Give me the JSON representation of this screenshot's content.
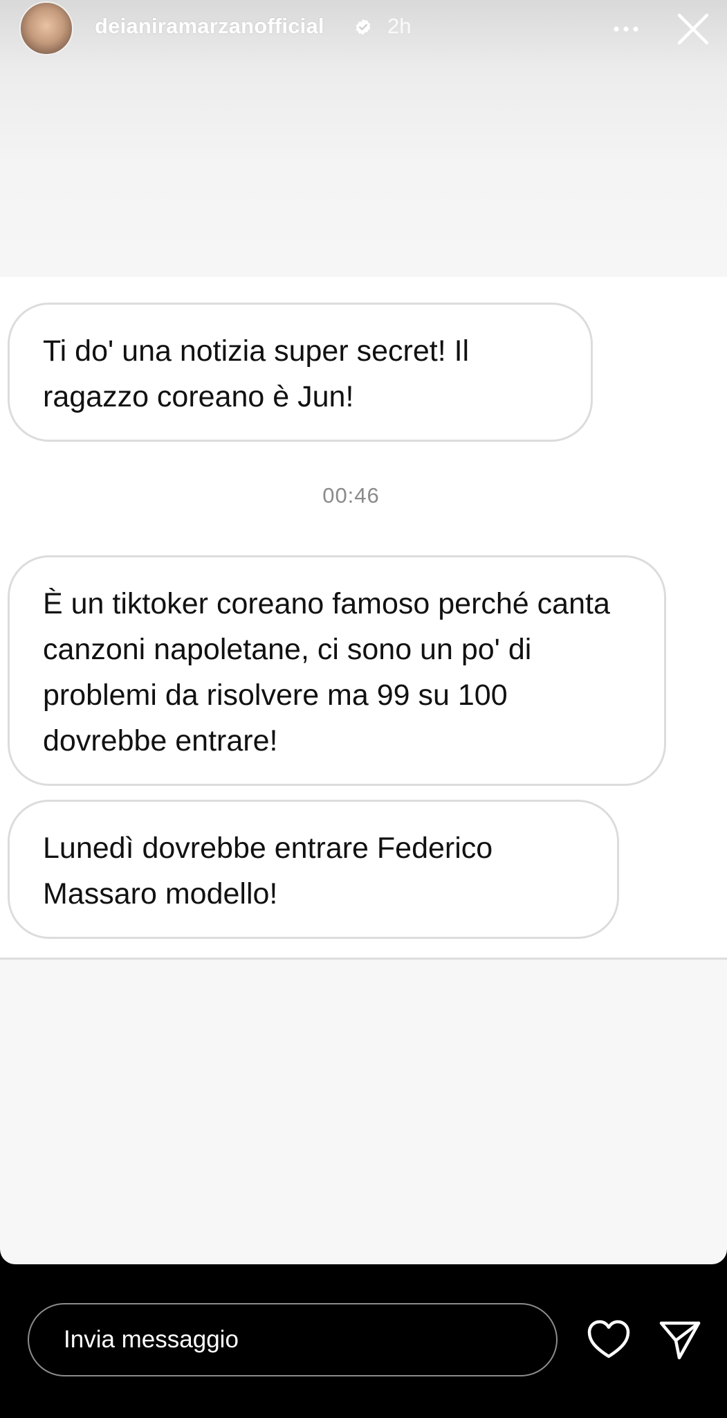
{
  "story": {
    "username": "deianiramarzanofficial",
    "posted_ago": "2h",
    "avatar_icon": "avatar",
    "verified_icon": "verified-badge-icon"
  },
  "messages": [
    {
      "text": "Ti do' una notizia super secret! Il ragazzo coreano è Jun!"
    },
    {
      "text": "È un tiktoker coreano famoso perché canta canzoni napoletane, ci sono un po' di problemi da risolvere ma 99 su 100 dovrebbe entrare!"
    },
    {
      "text": "Lunedì dovrebbe entrare Federico Massaro modello!"
    }
  ],
  "timestamp": "00:46",
  "reply": {
    "placeholder": "Invia messaggio"
  },
  "colors": {
    "background": "#000000",
    "story_bg": "#f7f7f7",
    "bubble_border": "#dcdcdc",
    "timestamp": "#8a8a8a"
  }
}
